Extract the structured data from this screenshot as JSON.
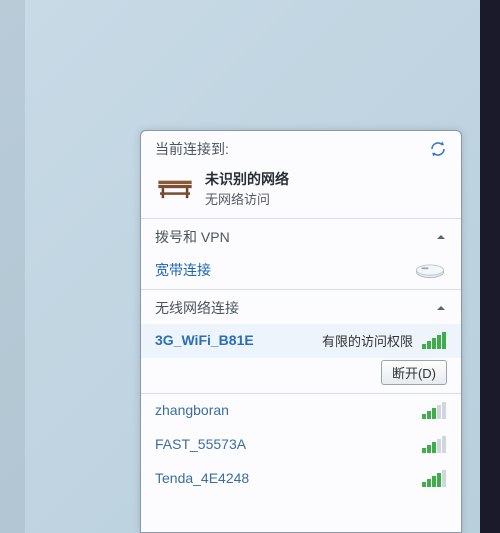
{
  "header": {
    "title": "当前连接到:"
  },
  "current": {
    "name": "未识别的网络",
    "status": "无网络访问"
  },
  "sections": {
    "dialup_vpn": {
      "label": "拨号和 VPN"
    },
    "broadband": {
      "label": "宽带连接"
    },
    "wireless": {
      "label": "无线网络连接"
    }
  },
  "connected": {
    "ssid": "3G_WiFi_B81E",
    "status": "有限的访问权限",
    "disconnect_label": "断开(D)"
  },
  "networks": [
    {
      "ssid": "zhangboran"
    },
    {
      "ssid": "FAST_55573A"
    },
    {
      "ssid": "Tenda_4E4248"
    }
  ]
}
